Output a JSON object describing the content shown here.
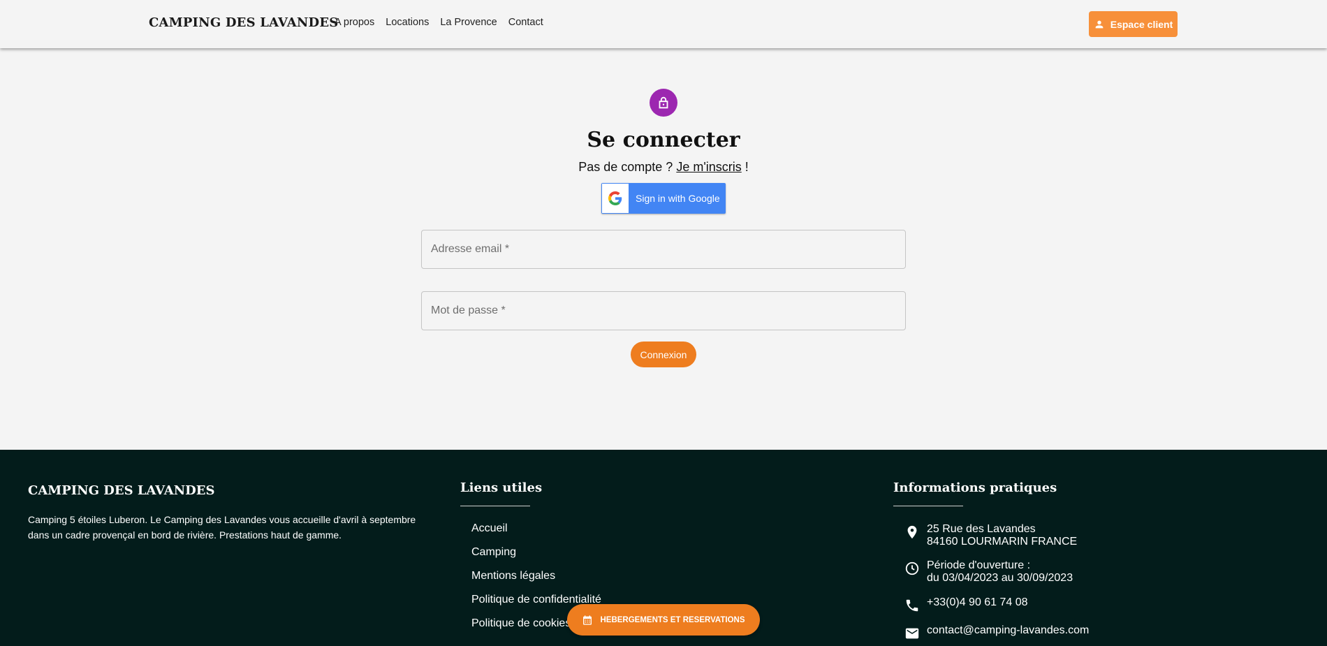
{
  "header": {
    "brand": "CAMPING DES LAVANDES",
    "nav": [
      "A propos",
      "Locations",
      "La Provence",
      "Contact"
    ],
    "espace_label": "Espace client"
  },
  "login": {
    "title": "Se connecter",
    "signup_prefix": "Pas de compte ? ",
    "signup_link": "Je m'inscris",
    "signup_suffix": " !",
    "google_label": "Sign in with Google",
    "email_placeholder": "Adresse email *",
    "password_placeholder": "Mot de passe *",
    "submit_label": "Connexion"
  },
  "footer": {
    "brand": "CAMPING DES LAVANDES",
    "description": "Camping 5 étoiles Luberon. Le Camping des Lavandes vous accueille d'avril à septembre dans un cadre provençal en bord de rivière. Prestations haut de gamme.",
    "links_title": "Liens utiles",
    "links": [
      "Accueil",
      "Camping",
      "Mentions légales",
      "Politique de confidentialité",
      "Politique de cookies"
    ],
    "info_title": "Informations pratiques",
    "address_line1": "25 Rue des Lavandes",
    "address_line2": "84160 LOURMARIN FRANCE",
    "hours_line1": "Période d'ouverture :",
    "hours_line2": "du 03/04/2023 au 30/09/2023",
    "phone": "+33(0)4 90 61 74 08",
    "email": "contact@camping-lavandes.com"
  },
  "fab_label": "HEBERGEMENTS ET RESERVATIONS",
  "colors": {
    "accent": "#ee7d1f",
    "lock": "#9c27b0",
    "google": "#4285f4",
    "footer_bg": "#031c1b"
  }
}
